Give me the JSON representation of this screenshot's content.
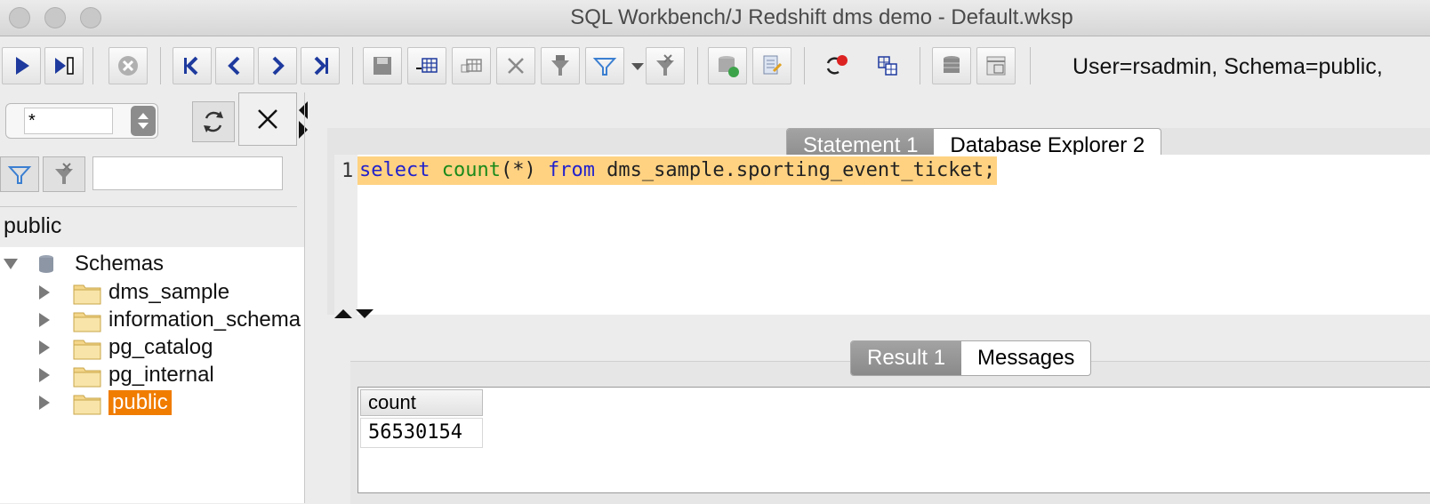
{
  "window": {
    "title": "SQL Workbench/J Redshift dms demo - Default.wksp"
  },
  "toolbar": {
    "status": "User=rsadmin, Schema=public,",
    "icons": [
      "execute-icon",
      "execute-current-icon",
      "stop-icon",
      "first-record-icon",
      "previous-record-icon",
      "next-record-icon",
      "last-record-icon",
      "save-icon",
      "insert-row-icon",
      "copy-row-icon",
      "delete-row-icon",
      "filter-funnel-icon",
      "filter-icon",
      "remove-filter-icon",
      "commit-icon",
      "rollback-icon",
      "connection-info-icon",
      "show-tables-icon",
      "database-icon",
      "db-explorer-icon"
    ]
  },
  "left": {
    "filter_value": "*",
    "schema_label": "public",
    "tree": {
      "root": "Schemas",
      "items": [
        {
          "label": "dms_sample",
          "selected": false
        },
        {
          "label": "information_schema",
          "selected": false
        },
        {
          "label": "pg_catalog",
          "selected": false
        },
        {
          "label": "pg_internal",
          "selected": false
        },
        {
          "label": "public",
          "selected": true
        }
      ]
    }
  },
  "tabs_top": [
    {
      "label": "Statement 1",
      "active": true
    },
    {
      "label": "Database Explorer 2",
      "active": false
    }
  ],
  "editor": {
    "line_number": "1",
    "tokens": [
      {
        "text": "select",
        "cls": "kw"
      },
      {
        "text": " ",
        "cls": "tx"
      },
      {
        "text": "count",
        "cls": "fn"
      },
      {
        "text": "(*) ",
        "cls": "tx"
      },
      {
        "text": "from",
        "cls": "kw"
      },
      {
        "text": " dms_sample.sporting_event_ticket;",
        "cls": "tx"
      }
    ]
  },
  "tabs_bottom": [
    {
      "label": "Result 1",
      "active": true
    },
    {
      "label": "Messages",
      "active": false
    }
  ],
  "result": {
    "column": "count",
    "value": "56530154"
  },
  "colors": {
    "highlight": "#ffd282",
    "selection": "#f07c00",
    "keyword": "#2222cc",
    "function": "#1a8a1a"
  }
}
